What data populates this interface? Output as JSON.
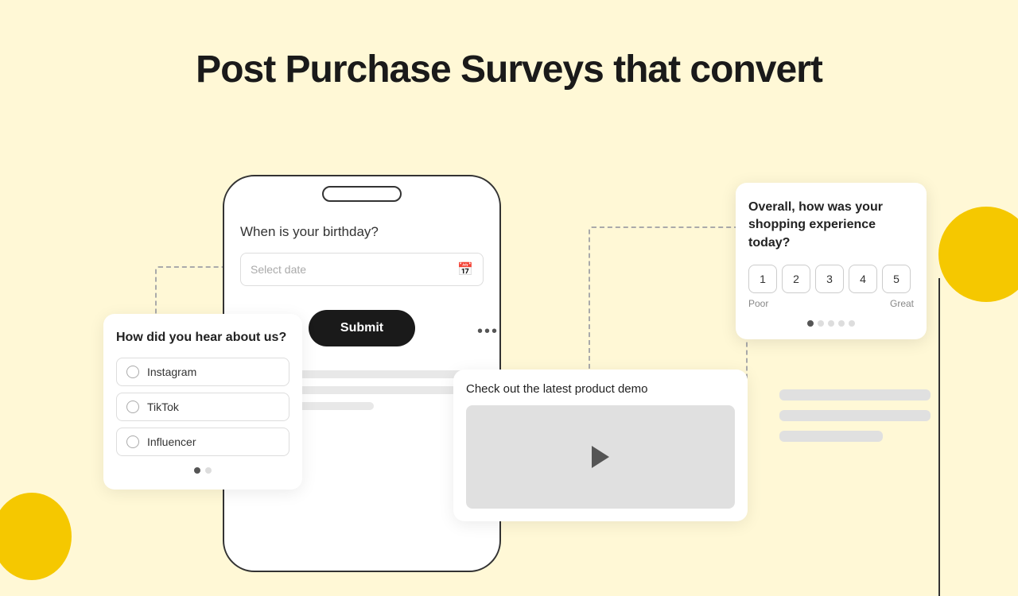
{
  "page": {
    "background": "#FFF8D6",
    "title": "Post Purchase Surveys that convert"
  },
  "phone": {
    "question": "When is your birthday?",
    "date_placeholder": "Select date",
    "submit_label": "Submit"
  },
  "hear_card": {
    "title": "How did you hear about us?",
    "options": [
      "Instagram",
      "TikTok",
      "Influencer"
    ],
    "dots": [
      true,
      false
    ]
  },
  "video_card": {
    "title": "Check out the latest product demo"
  },
  "rating_card": {
    "question": "Overall, how was your shopping experience today?",
    "numbers": [
      "1",
      "2",
      "3",
      "4",
      "5"
    ],
    "label_left": "Poor",
    "label_right": "Great",
    "dots": [
      true,
      false,
      false,
      false,
      false
    ]
  },
  "dots_menu": "•••"
}
